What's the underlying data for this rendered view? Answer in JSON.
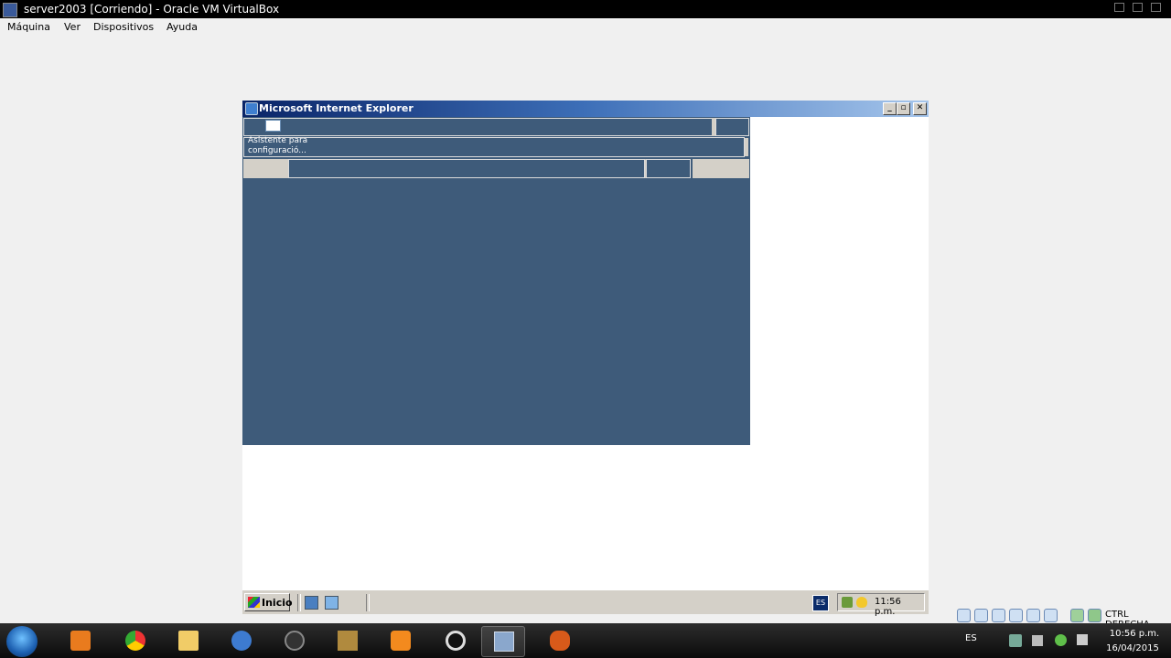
{
  "host_window": {
    "title": "server2003 [Corriendo] - Oracle VM VirtualBox",
    "menu": [
      "Máquina",
      "Ver",
      "Dispositivos",
      "Ayuda"
    ]
  },
  "ie_window": {
    "title": "Microsoft Internet Explorer",
    "wizard_text": "Asistente para configuració..."
  },
  "guest_taskbar": {
    "start_label": "Inicio",
    "language": "ES",
    "clock": "11:56 p.m."
  },
  "vbox_status": {
    "host_key": "CTRL DERECHA"
  },
  "host_taskbar": {
    "language": "ES",
    "time": "10:56 p.m.",
    "date": "16/04/2015",
    "apps": [
      "media-player-icon",
      "chrome-icon",
      "file-explorer-icon",
      "thunderbird-icon",
      "settings-icon",
      "dosbox-icon",
      "xampp-icon",
      "camera-icon",
      "virtualbox-icon",
      "hand-icon"
    ]
  },
  "colors": {
    "app_bg": "#3e5b7a",
    "ie_title_start": "#0a2467",
    "ie_title_end": "#a6c6ec",
    "classic_grey": "#d4d0c8"
  }
}
